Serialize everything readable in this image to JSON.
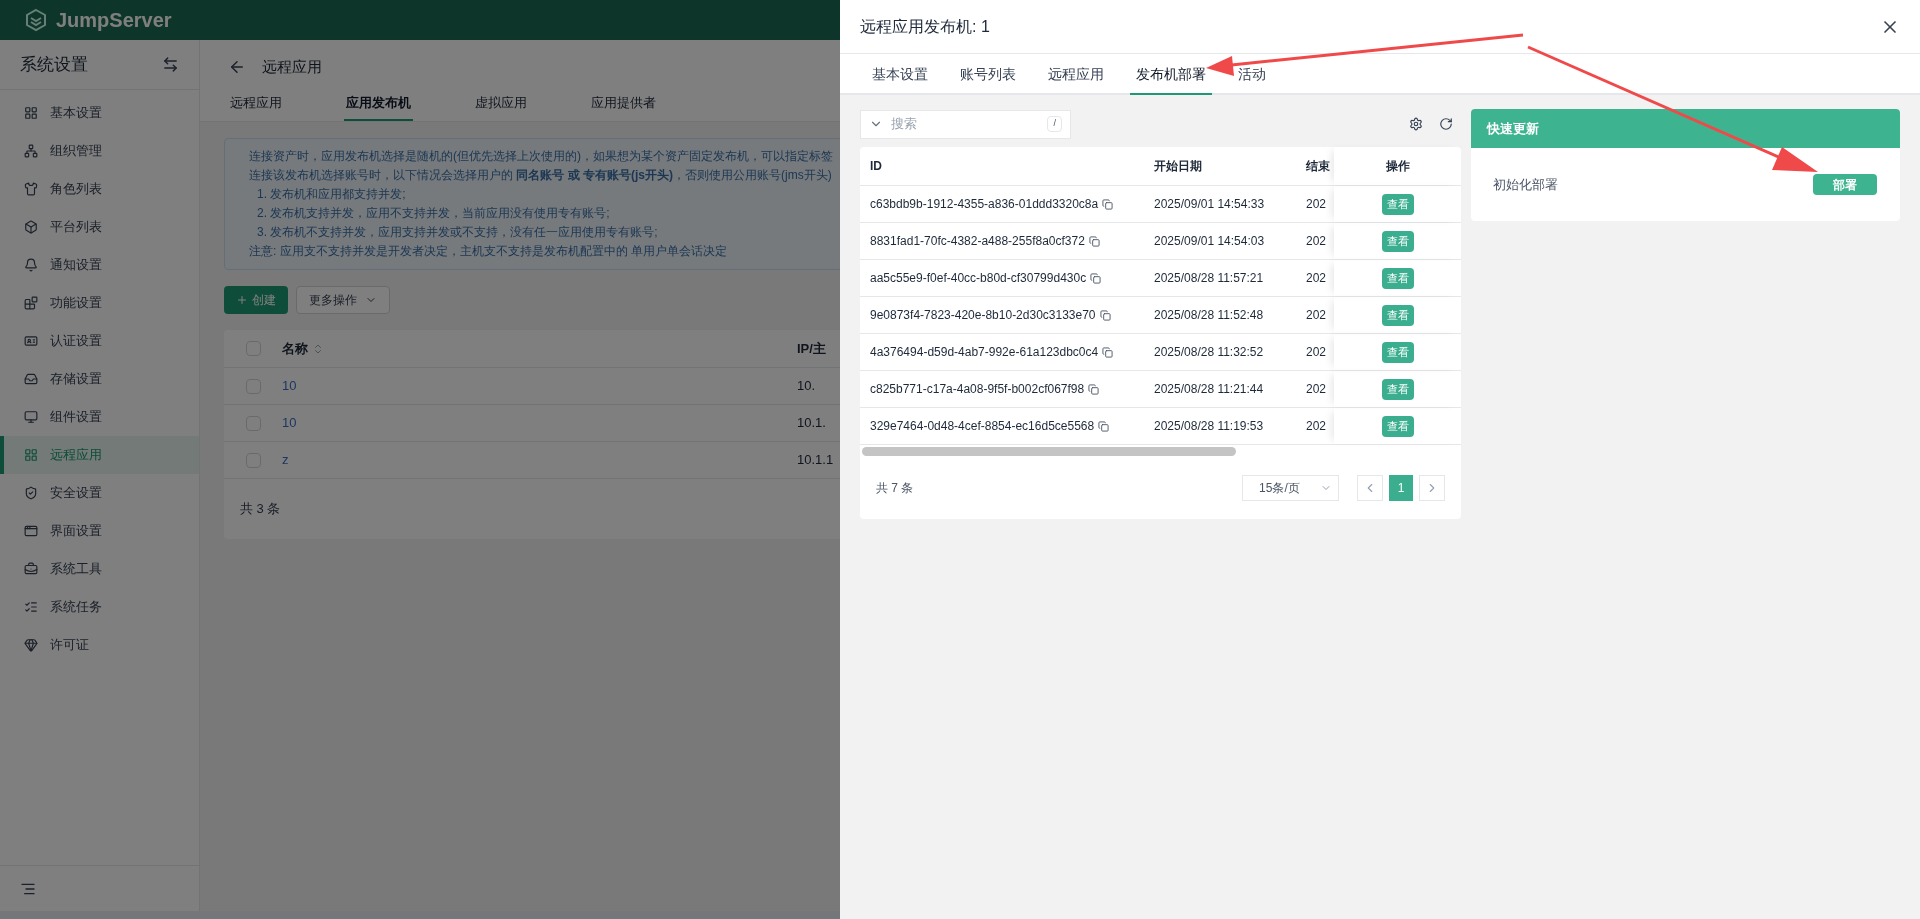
{
  "app": {
    "logo": "JumpServer"
  },
  "sidebar": {
    "title": "系统设置",
    "items": [
      {
        "label": "基本设置",
        "selected": false
      },
      {
        "label": "组织管理",
        "selected": false
      },
      {
        "label": "角色列表",
        "selected": false
      },
      {
        "label": "平台列表",
        "selected": false
      },
      {
        "label": "通知设置",
        "selected": false
      },
      {
        "label": "功能设置",
        "selected": false
      },
      {
        "label": "认证设置",
        "selected": false
      },
      {
        "label": "存储设置",
        "selected": false
      },
      {
        "label": "组件设置",
        "selected": false
      },
      {
        "label": "远程应用",
        "selected": true
      },
      {
        "label": "安全设置",
        "selected": false
      },
      {
        "label": "界面设置",
        "selected": false
      },
      {
        "label": "系统工具",
        "selected": false
      },
      {
        "label": "系统任务",
        "selected": false
      },
      {
        "label": "许可证",
        "selected": false
      }
    ]
  },
  "page": {
    "title": "远程应用",
    "tabs": [
      {
        "label": "远程应用",
        "selected": false
      },
      {
        "label": "应用发布机",
        "selected": true
      },
      {
        "label": "虚拟应用",
        "selected": false
      },
      {
        "label": "应用提供者",
        "selected": false
      }
    ],
    "notice": [
      "连接资产时，应用发布机选择是随机的(但优先选择上次使用的)，如果想为某个资产固定发布机，可以指定标签",
      "连接该发布机选择账号时，以下情况会选择用户的 **同名账号 或 专有账号(js开头)**，否则使用公用账号(jms开头)",
      "1. 发布机和应用都支持并发;",
      "2. 发布机支持并发，应用不支持并发，当前应用没有使用专有账号;",
      "3. 发布机不支持并发，应用支持并发或不支持，没有任一应用使用专有账号;",
      "注意: 应用支不支持并发是开发者决定，主机支不支持是发布机配置中的 单用户单会话决定"
    ],
    "create_button": "创建",
    "more_button": "更多操作",
    "table": {
      "select_all": {
        "checked": false
      },
      "columns": [
        "名称",
        "IP/主"
      ],
      "rows": [
        {
          "name": "10",
          "ip": "10.",
          "checked": false
        },
        {
          "name": "10",
          "ip": "10.1.",
          "checked": false
        },
        {
          "name": "z",
          "ip": "10.1.1",
          "checked": false
        }
      ]
    },
    "total": "共 3 条"
  },
  "drawer": {
    "title": "远程应用发布机: 1",
    "tabs": [
      {
        "label": "基本设置",
        "selected": false
      },
      {
        "label": "账号列表",
        "selected": false
      },
      {
        "label": "远程应用",
        "selected": false
      },
      {
        "label": "发布机部署",
        "selected": true
      },
      {
        "label": "活动",
        "selected": false
      }
    ],
    "search": {
      "placeholder": "搜索",
      "shortcut": "/"
    },
    "table": {
      "columns": [
        "ID",
        "开始日期",
        "结束",
        "操作"
      ],
      "rows": [
        {
          "id": "c63bdb9b-1912-4355-a836-01ddd3320c8a",
          "start": "2025/09/01 14:54:33",
          "end": "202",
          "action": "查看"
        },
        {
          "id": "8831fad1-70fc-4382-a488-255f8a0cf372",
          "start": "2025/09/01 14:54:03",
          "end": "202",
          "action": "查看"
        },
        {
          "id": "aa5c55e9-f0ef-40cc-b80d-cf30799d430c",
          "start": "2025/08/28 11:57:21",
          "end": "202",
          "action": "查看"
        },
        {
          "id": "9e0873f4-7823-420e-8b10-2d30c3133e70",
          "start": "2025/08/28 11:52:48",
          "end": "202",
          "action": "查看"
        },
        {
          "id": "4a376494-d59d-4ab7-992e-61a123dbc0c4",
          "start": "2025/08/28 11:32:52",
          "end": "202",
          "action": "查看"
        },
        {
          "id": "c825b771-c17a-4a08-9f5f-b002cf067f98",
          "start": "2025/08/28 11:21:44",
          "end": "202",
          "action": "查看"
        },
        {
          "id": "329e7464-0d48-4cef-8854-ec16d5ce5568",
          "start": "2025/08/28 11:19:53",
          "end": "202",
          "action": "查看"
        }
      ]
    },
    "total": "共 7 条",
    "page_size": "15条/页",
    "pages": [
      {
        "label": "1",
        "selected": true
      }
    ],
    "quick_update": {
      "title": "快速更新",
      "items": [
        {
          "label": "初始化部署",
          "button": "部署"
        }
      ]
    }
  }
}
